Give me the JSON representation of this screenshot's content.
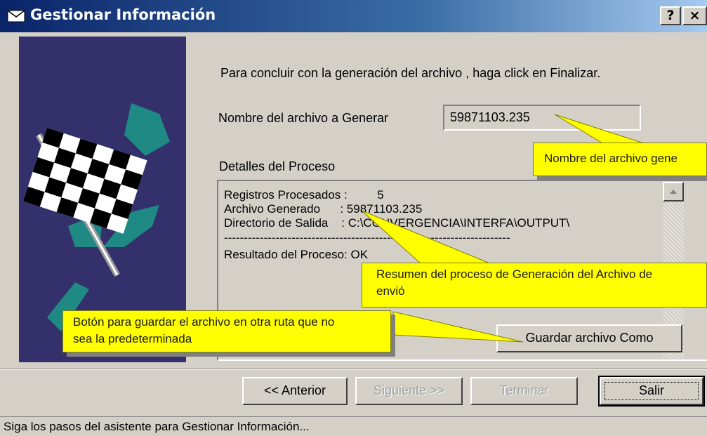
{
  "window": {
    "title": "Gestionar Información",
    "help_button": "?",
    "close_button": "×",
    "title_icon": "envelope-icon"
  },
  "side_image": {
    "icon": "checkered-flag-icon",
    "background": "#34306c",
    "accent": "#1f8a84"
  },
  "main": {
    "instruction": "Para concluir con la generación del archivo , haga click en Finalizar.",
    "filename_label": "Nombre del archivo a Generar",
    "filename_value": "59871103.235",
    "details_label": "Detalles del Proceso",
    "details_lines": [
      "Registros Procesados :         5",
      "Archivo Generado      : 59871103.235",
      "Directorio de Salida    : C:\\CONVERGENCIA\\INTERFA\\OUTPUT\\",
      "------------------------------------------------------------------------",
      "Resultado del Proceso: OK"
    ],
    "save_as_button": "Guardar archivo Como"
  },
  "nav_buttons": {
    "previous": "<< Anterior",
    "next": "Siguiente >>",
    "finish": "Terminar",
    "exit": "Salir"
  },
  "status_bar": "Siga los pasos del asistente para Gestionar Información...",
  "callouts": {
    "filename": "Nombre del archivo gene",
    "summary_line1": "Resumen del proceso de Generación del Archivo de",
    "summary_line2": "envió",
    "save_line1": "Botón para guardar el archivo en otra ruta que no",
    "save_line2": "sea la predeterminada",
    "color": "#ffff00"
  }
}
